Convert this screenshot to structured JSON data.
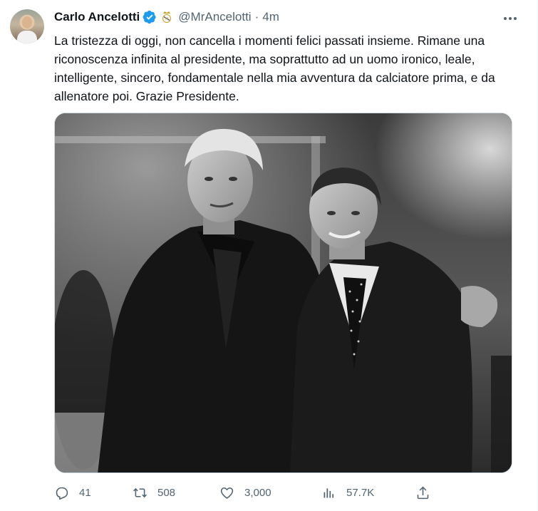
{
  "author": {
    "name": "Carlo Ancelotti",
    "handle": "@MrAncelotti",
    "separator": "·",
    "time": "4m"
  },
  "icons": {
    "verified": "verified-badge-icon",
    "club": "club-crest-icon",
    "more": "more-options-icon",
    "reply": "reply-icon",
    "retweet": "retweet-icon",
    "like": "heart-icon",
    "views": "views-icon",
    "share": "share-icon"
  },
  "colors": {
    "verified_blue": "#1d9bf0",
    "secondary_text": "#536471",
    "primary_text": "#0f1419"
  },
  "tweet": {
    "text": "La tristezza di oggi, non cancella i momenti felici passati insieme. Rimane una riconoscenza infinita al presidente, ma soprattutto ad un uomo ironico, leale, intelligente, sincero, fondamentale nella mia avventura da calciatore prima, e da allenatore poi. Grazie Presidente."
  },
  "stats": {
    "replies": "41",
    "retweets": "508",
    "likes": "3,000",
    "views": "57.7K"
  }
}
